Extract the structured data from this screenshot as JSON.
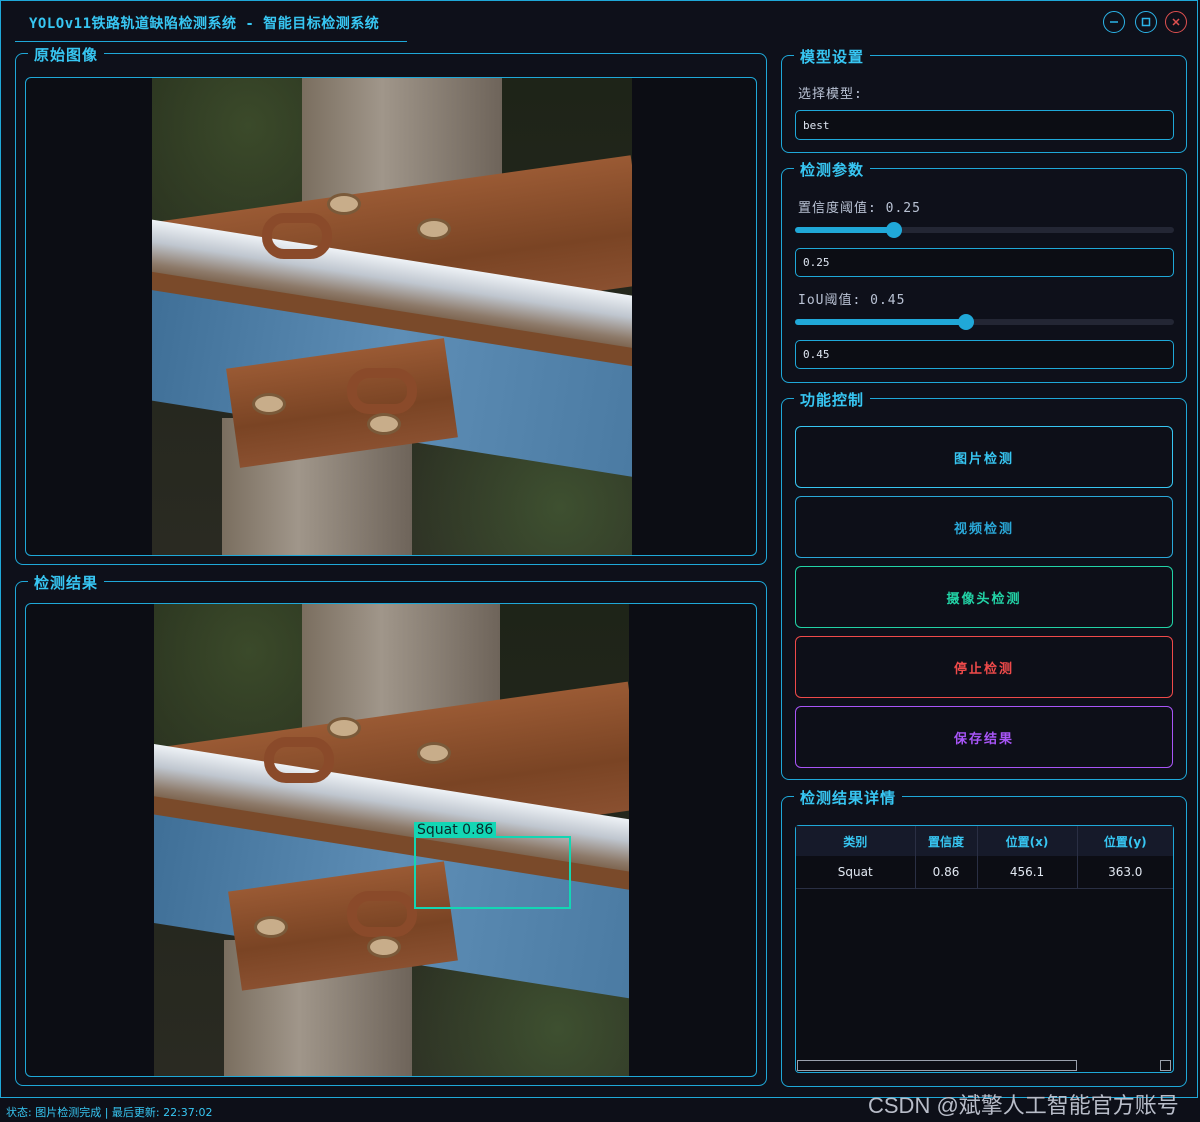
{
  "window": {
    "title": "YOLOv11铁路轨道缺陷检测系统 - 智能目标检测系统"
  },
  "panels": {
    "original_title": "原始图像",
    "result_title": "检测结果"
  },
  "detection_overlay": {
    "label": "Squat 0.86"
  },
  "model": {
    "group_title": "模型设置",
    "select_label": "选择模型:",
    "selected": "best"
  },
  "params": {
    "group_title": "检测参数",
    "conf_label": "置信度阈值: 0.25",
    "conf_value": "0.25",
    "conf_fraction": 0.26,
    "iou_label": "IoU阈值: 0.45",
    "iou_value": "0.45",
    "iou_fraction": 0.45
  },
  "controls": {
    "group_title": "功能控制",
    "image_detect": "图片检测",
    "video_detect": "视频检测",
    "camera_detect": "摄像头检测",
    "stop_detect": "停止检测",
    "save_result": "保存结果",
    "colors": {
      "image": "#37c6f2",
      "video": "#2aa8d8",
      "camera": "#22d3a6",
      "stop": "#ef4a4a",
      "save": "#a855f7"
    }
  },
  "results": {
    "group_title": "检测结果详情",
    "columns": [
      "类别",
      "置信度",
      "位置(x)",
      "位置(y)"
    ],
    "rows": [
      [
        "Squat",
        "0.86",
        "456.1",
        "363.0"
      ]
    ]
  },
  "status_bar": {
    "text": "状态: 图片检测完成 | 最后更新: 22:37:02"
  },
  "watermark": "CSDN @斌擎人工智能官方账号"
}
